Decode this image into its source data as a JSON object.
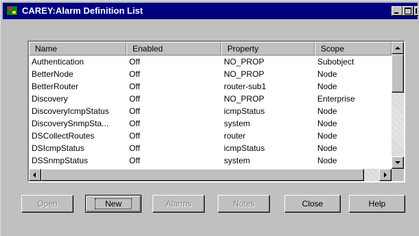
{
  "window": {
    "title": "CAREY:Alarm Definition List"
  },
  "list": {
    "columns": [
      "Name",
      "Enabled",
      "Property",
      "Scope"
    ],
    "rows": [
      {
        "name": "Authentication",
        "enabled": "Off",
        "property": "NO_PROP",
        "scope": "Subobject"
      },
      {
        "name": "BetterNode",
        "enabled": "Off",
        "property": "NO_PROP",
        "scope": "Node"
      },
      {
        "name": "BetterRouter",
        "enabled": "Off",
        "property": "router-sub1",
        "scope": "Node"
      },
      {
        "name": "Discovery",
        "enabled": "Off",
        "property": "NO_PROP",
        "scope": "Enterprise"
      },
      {
        "name": "DiscoveryIcmpStatus",
        "enabled": "Off",
        "property": "icmpStatus",
        "scope": "Node"
      },
      {
        "name": "DiscoverySnmpSta...",
        "enabled": "Off",
        "property": "system",
        "scope": "Node"
      },
      {
        "name": "DSCollectRoutes",
        "enabled": "Off",
        "property": "router",
        "scope": "Node"
      },
      {
        "name": "DSIcmpStatus",
        "enabled": "Off",
        "property": "icmpStatus",
        "scope": "Node"
      },
      {
        "name": "DSSnmpStatus",
        "enabled": "Off",
        "property": "system",
        "scope": "Node"
      }
    ]
  },
  "buttons": {
    "open": "Open",
    "new": "New",
    "alarms": "Alarms",
    "notes": "Notes",
    "close": "Close",
    "help": "Help"
  },
  "colors": {
    "titlebar": "#000080",
    "face": "#c0c0c0"
  },
  "icons": [
    "app-icon",
    "minimize-icon",
    "maximize-icon",
    "close-icon",
    "arrow-up-icon",
    "arrow-down-icon",
    "arrow-left-icon",
    "arrow-right-icon"
  ]
}
